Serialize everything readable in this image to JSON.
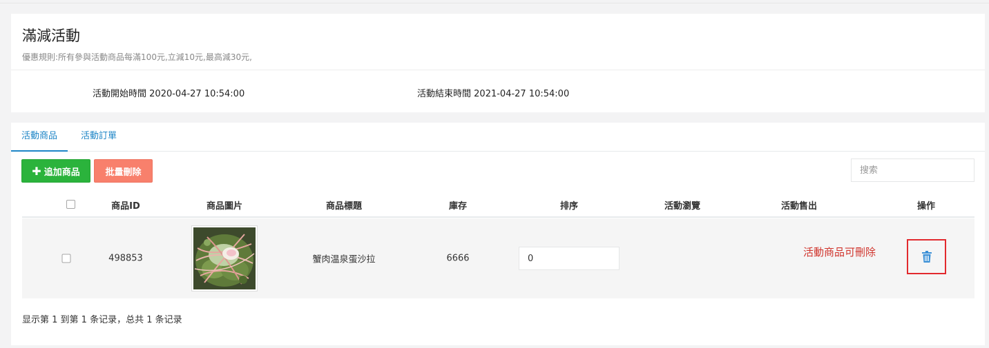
{
  "header": {
    "title": "滿減活動",
    "rule": "優惠規則:所有參與活動商品每滿100元,立減10元,最高減30元,",
    "start_label": "活動開始時間",
    "start_time": "2020-04-27 10:54:00",
    "end_label": "活動結束時間",
    "end_time": "2021-04-27 10:54:00"
  },
  "tabs": [
    {
      "label": "活動商品",
      "active": true
    },
    {
      "label": "活動訂單",
      "active": false
    }
  ],
  "toolbar": {
    "add_label": "追加商品",
    "delete_label": "批量刪除",
    "search_placeholder": "搜索"
  },
  "table": {
    "columns": [
      "商品ID",
      "商品圖片",
      "商品標題",
      "庫存",
      "排序",
      "活動瀏覽",
      "活動售出",
      "操作"
    ],
    "rows": [
      {
        "id": "498853",
        "image": "crab-egg-salad-photo",
        "title": "蟹肉温泉蛋沙拉",
        "stock": "6666",
        "sort": "0",
        "views": "",
        "sold": "",
        "action_icon": "trash-icon"
      }
    ],
    "annotation": "活動商品可刪除"
  },
  "footer": {
    "summary": "显示第 1 到第 1 条记录，总共 1 条记录"
  },
  "colors": {
    "accent": "#1c84c6",
    "add": "#2bb33c",
    "delete": "#f8806c",
    "annotation": "#d0342c",
    "highlight": "#e2292d"
  }
}
